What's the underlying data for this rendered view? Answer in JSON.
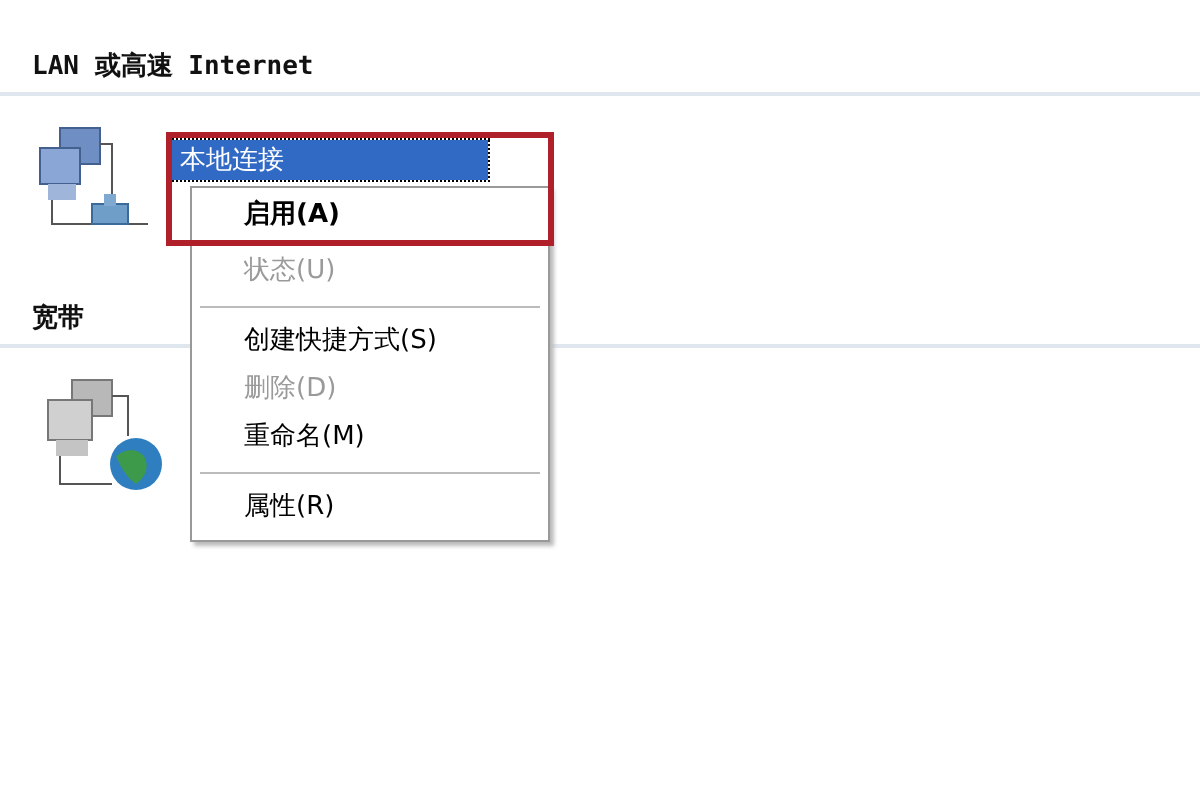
{
  "sections": [
    {
      "title": "LAN 或高速 Internet",
      "kind": "lan",
      "items": [
        {
          "label": "本地连接",
          "selected": true
        }
      ]
    },
    {
      "title": "宽带",
      "kind": "broadband"
    }
  ],
  "context_menu": {
    "items": [
      {
        "kind": "item",
        "label": "启用(A)",
        "default": true,
        "disabled": false
      },
      {
        "kind": "item",
        "label": "状态(U)",
        "default": false,
        "disabled": true
      },
      {
        "kind": "separator"
      },
      {
        "kind": "item",
        "label": "创建快捷方式(S)",
        "default": false,
        "disabled": false
      },
      {
        "kind": "item",
        "label": "删除(D)",
        "default": false,
        "disabled": true
      },
      {
        "kind": "item",
        "label": "重命名(M)",
        "default": false,
        "disabled": false
      },
      {
        "kind": "separator"
      },
      {
        "kind": "item",
        "label": "属性(R)",
        "default": false,
        "disabled": false
      }
    ]
  }
}
